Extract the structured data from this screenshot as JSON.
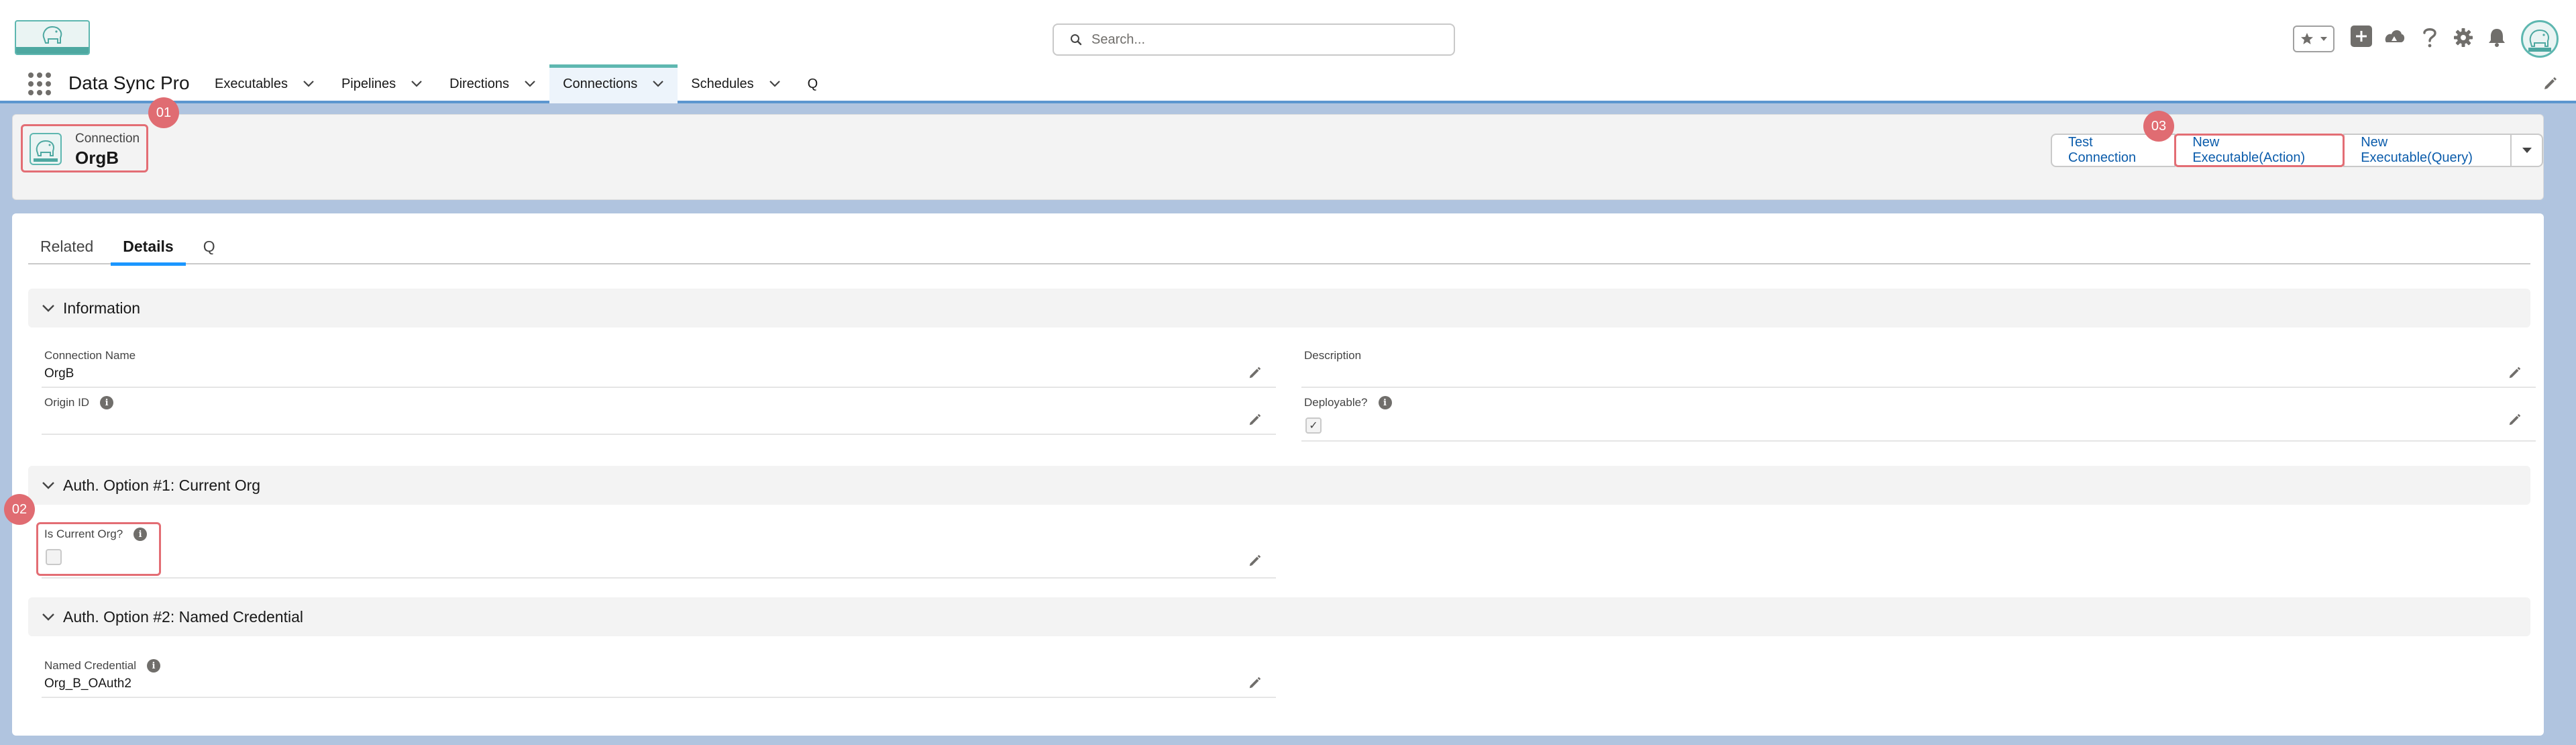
{
  "search": {
    "placeholder": "Search..."
  },
  "nav": {
    "app_name": "Data Sync Pro",
    "items": [
      {
        "label": "Executables"
      },
      {
        "label": "Pipelines"
      },
      {
        "label": "Directions"
      },
      {
        "label": "Connections",
        "active": true
      },
      {
        "label": "Schedules"
      },
      {
        "label": "Q"
      }
    ]
  },
  "record": {
    "type": "Connection",
    "title": "OrgB"
  },
  "actions": {
    "test": "Test Connection",
    "new_action": "New Executable(Action)",
    "new_query": "New Executable(Query)"
  },
  "annotations": {
    "a1": "01",
    "a2": "02",
    "a3": "03"
  },
  "tabs": {
    "related": "Related",
    "details": "Details",
    "q": "Q"
  },
  "sections": {
    "info": "Information",
    "auth1": "Auth. Option #1: Current Org",
    "auth2": "Auth. Option #2: Named Credential"
  },
  "fields": {
    "connection_name": {
      "label": "Connection Name",
      "value": "OrgB"
    },
    "description": {
      "label": "Description",
      "value": ""
    },
    "origin_id": {
      "label": "Origin ID",
      "value": ""
    },
    "deployable": {
      "label": "Deployable?",
      "checked": true
    },
    "is_current_org": {
      "label": "Is Current Org?",
      "checked": false
    },
    "named_credential": {
      "label": "Named Credential",
      "value": "Org_B_OAuth2"
    }
  },
  "colors": {
    "brand_teal": "#5eb7b0",
    "link_blue": "#0b5cab",
    "annotation_red": "#e06c72",
    "page_bg": "#b0c4df"
  },
  "icons": [
    "search-icon",
    "star-icon",
    "plus-icon",
    "trailhead-icon",
    "help-icon",
    "gear-icon",
    "bell-icon",
    "pencil-icon",
    "info-icon",
    "chevron-down-icon"
  ]
}
